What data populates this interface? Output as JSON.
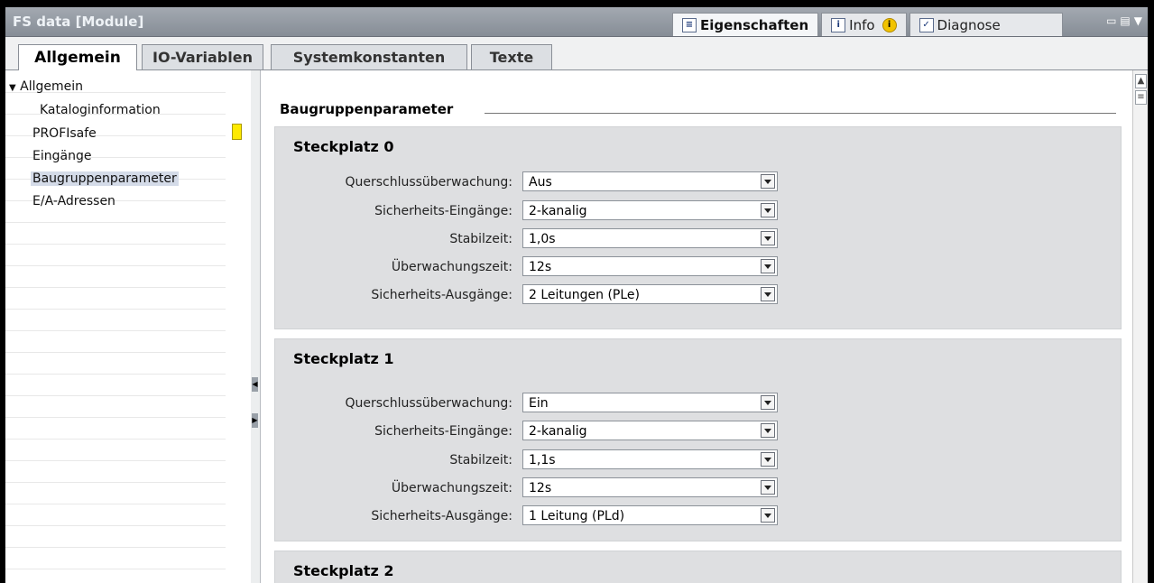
{
  "window": {
    "title": "FS data [Module]"
  },
  "inspector_tabs": [
    {
      "label": "Eigenschaften",
      "icon": "properties-icon"
    },
    {
      "label": "Info",
      "icon": "info-icon"
    },
    {
      "label": "Diagnose",
      "icon": "diagnose-icon"
    }
  ],
  "tabs": [
    "Allgemein",
    "IO-Variablen",
    "Systemkonstanten",
    "Texte"
  ],
  "nav": {
    "group": "Allgemein",
    "items": [
      "Kataloginformation",
      "PROFIsafe",
      "Eingänge",
      "Baugruppenparameter",
      "E/A-Adressen"
    ],
    "selected": "Baugruppenparameter"
  },
  "section": {
    "title": "Baugruppenparameter"
  },
  "slots": [
    {
      "title": "Steckplatz 0",
      "params": [
        {
          "label": "Querschlussüberwachung:",
          "value": "Aus"
        },
        {
          "label": "Sicherheits-Eingänge:",
          "value": "2-kanalig"
        },
        {
          "label": "Stabilzeit:",
          "value": "1,0s"
        },
        {
          "label": "Überwachungszeit:",
          "value": "12s"
        },
        {
          "label": "Sicherheits-Ausgänge:",
          "value": "2 Leitungen (PLe)"
        }
      ]
    },
    {
      "title": "Steckplatz 1",
      "params": [
        {
          "label": "Querschlussüberwachung:",
          "value": "Ein"
        },
        {
          "label": "Sicherheits-Eingänge:",
          "value": "2-kanalig"
        },
        {
          "label": "Stabilzeit:",
          "value": "1,1s"
        },
        {
          "label": "Überwachungszeit:",
          "value": "12s"
        },
        {
          "label": "Sicherheits-Ausgänge:",
          "value": "1 Leitung (PLd)"
        }
      ]
    },
    {
      "title": "Steckplatz 2",
      "params": []
    }
  ],
  "colors": {
    "titlebar": "#949aa3",
    "panel": "#dedfe1",
    "selected_nav": "#d4dbe8",
    "marker": "#ffea00"
  }
}
